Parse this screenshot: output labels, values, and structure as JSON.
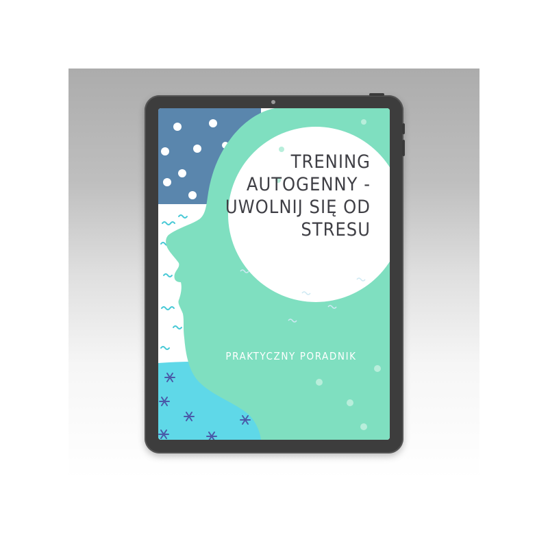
{
  "ebook": {
    "title_lines": [
      "TRENING",
      "AUTOGENNY -",
      "UWOLNIJ SIĘ OD",
      "STRESU"
    ],
    "subtitle": "PRAKTYCZNY PORADNIK"
  },
  "colors": {
    "blue": "#5a86ad",
    "mint": "#7fdfc0",
    "cyan": "#5fd8e8",
    "text": "#3f3f45"
  }
}
